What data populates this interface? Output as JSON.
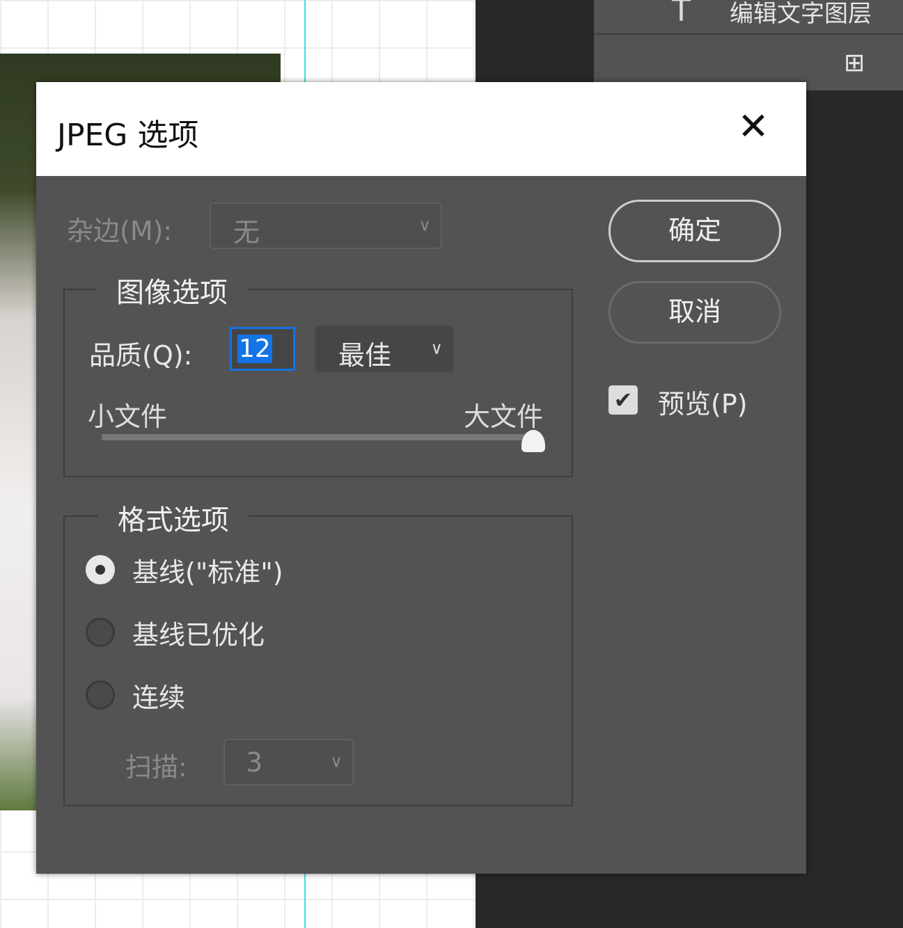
{
  "background": {
    "right_panel_text": "编辑文字图层",
    "icons": [
      "text-tool-icon",
      "add-layer-icon"
    ]
  },
  "dialog": {
    "title": "JPEG 选项",
    "close_icon": "close-icon",
    "matte": {
      "label": "杂边(M):",
      "value": "无",
      "disabled": true
    },
    "image_options": {
      "legend": "图像选项",
      "quality_label": "品质(Q):",
      "quality_value": "12",
      "quality_preset": "最佳",
      "small_file": "小文件",
      "large_file": "大文件",
      "slider_value": 12,
      "slider_range": [
        0,
        12
      ]
    },
    "format_options": {
      "legend": "格式选项",
      "options": [
        {
          "label": "基线(\"标准\")",
          "selected": true
        },
        {
          "label": "基线已优化",
          "selected": false
        },
        {
          "label": "连续",
          "selected": false
        }
      ],
      "scans_label": "扫描:",
      "scans_value": "3",
      "scans_disabled": true
    },
    "ok_label": "确定",
    "cancel_label": "取消",
    "preview_label": "预览(P)",
    "preview_checked": true,
    "accent_color": "#1473e6"
  }
}
